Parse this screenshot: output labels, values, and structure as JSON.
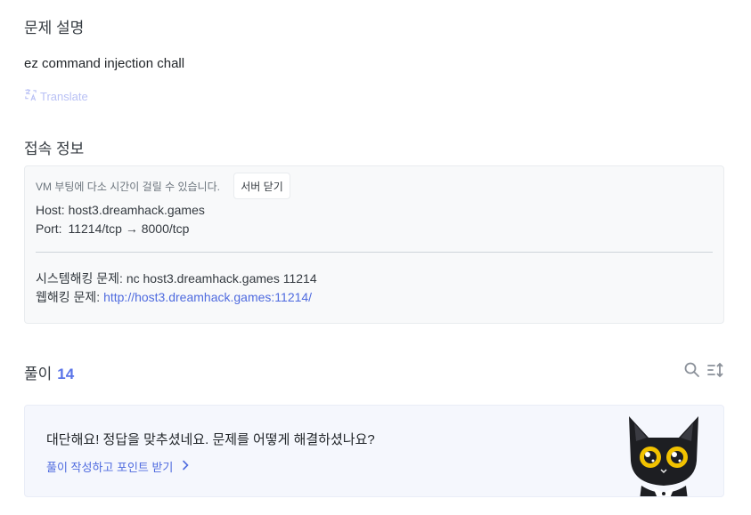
{
  "description": {
    "title": "문제 설명",
    "text": "ez command injection chall",
    "translate_label": "Translate"
  },
  "access": {
    "title": "접속 정보",
    "vm_note": "VM 부팅에 다소 시간이 걸릴 수 있습니다.",
    "close_button": "서버 닫기",
    "host_label": "Host:",
    "host_value": "host3.dreamhack.games",
    "port_label": "Port:",
    "port_value": "11214/tcp → 8000/tcp",
    "system_label": "시스템해킹 문제:",
    "system_value": "nc host3.dreamhack.games 11214",
    "web_label": "웹해킹 문제:",
    "web_value": "http://host3.dreamhack.games:11214/"
  },
  "solutions": {
    "title": "풀이",
    "count": "14",
    "icons": [
      "search-icon",
      "sort-icon"
    ]
  },
  "congrats": {
    "message": "대단해요! 정답을 맞추셨네요. 문제를 어떻게 해결하셨나요?",
    "link": "풀이 작성하고 포인트 받기",
    "mascot": "black-cat-mascot"
  },
  "colors": {
    "accent": "#4f6bdf",
    "count": "#5a74e8",
    "translate": "#b9c1f5"
  }
}
